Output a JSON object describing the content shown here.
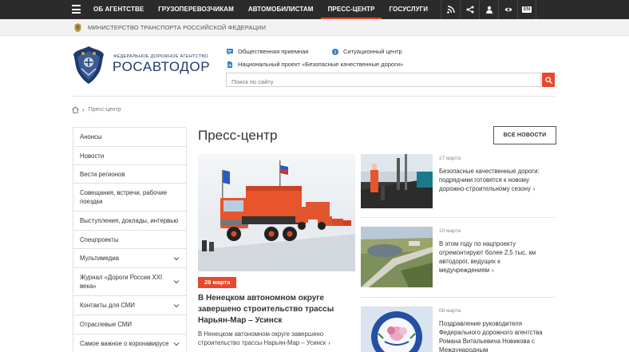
{
  "topbar": {
    "menu_icon": "hamburger-icon",
    "nav": [
      "ОБ АГЕНТСТВЕ",
      "ГРУЗОПЕРЕВОЗЧИКАМ",
      "АВТОМОБИЛИСТАМ",
      "ПРЕСС-ЦЕНТР",
      "ГОСУСЛУГИ"
    ],
    "active_nav": "ПРЕСС-ЦЕНТР",
    "icons": [
      "rss-icon",
      "share-icon",
      "user-icon",
      "eye-icon"
    ],
    "lang": "EN"
  },
  "ministry": {
    "text": "МИНИСТЕРСТВО ТРАНСПОРТА РОССИЙСКОЙ ФЕДЕРАЦИИ"
  },
  "header": {
    "agency_small": "ФЕДЕРАЛЬНОЕ ДОРОЖНОЕ АГЕНТСТВО",
    "agency_big": "РОСАВТОДОР",
    "link_reception": "Общественная приемная",
    "link_situation": "Ситуационный центр",
    "link_project": "Национальный проект «Безопасные качественные дороги»",
    "search_placeholder": "Поиск по сайту"
  },
  "breadcrumb": {
    "current": "Пресс-центр"
  },
  "sidebar": {
    "items": [
      {
        "label": "Анонсы",
        "expandable": false
      },
      {
        "label": "Новости",
        "expandable": false
      },
      {
        "label": "Вести регионов",
        "expandable": false
      },
      {
        "label": "Совещания, встречи, рабочие поездки",
        "expandable": false
      },
      {
        "label": "Выступления, доклады, интервью",
        "expandable": false
      },
      {
        "label": "Спецпроекты",
        "expandable": false
      },
      {
        "label": "Мультимедиа",
        "expandable": true
      },
      {
        "label": "Журнал «Дороги России XXI века»",
        "expandable": true
      },
      {
        "label": "Контакты для СМИ",
        "expandable": true
      },
      {
        "label": "Отраслевые СМИ",
        "expandable": false
      },
      {
        "label": "Самое важное о коронавирусе",
        "expandable": true
      }
    ]
  },
  "main": {
    "title": "Пресс-центр",
    "all_news": "ВСЕ НОВОСТИ",
    "feature": {
      "date": "28 марта",
      "title": "В Ненецком автономном округе завершено строительство трассы Нарьян-Мар – Усинск",
      "text": "В Ненецком автономном округе завершено строительство трассы Нарьян-Мар – Усинск"
    },
    "news": [
      {
        "date": "27 марта",
        "title": "Безопасные качественные дороги: подрядчики готовятся к новому дорожно-строительному сезону"
      },
      {
        "date": "10 марта",
        "title": "В этом году по нацпроекту отремонтируют более 2,5 тыс. км автодорог, ведущих к медучреждениям"
      },
      {
        "date": "08 марта",
        "title": "Поздравление руководителя Федерального дорожного агентства Романа Витальевича Новикова с Международным"
      }
    ]
  },
  "colors": {
    "topbar_bg": "#2b2b2b",
    "accent": "#e8482e",
    "brand_blue": "#1e3a6e",
    "link_arrow": "#2d7fd0"
  }
}
